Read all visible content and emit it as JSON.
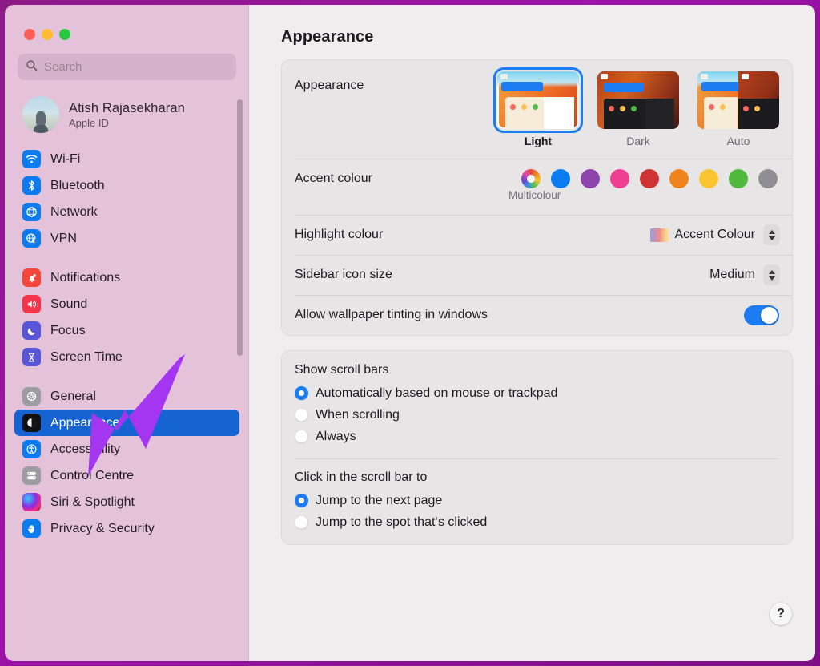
{
  "window": {
    "traffic_lights": [
      "close",
      "minimise",
      "zoom"
    ],
    "accent_hex": "#1d7cf2",
    "sidebar_bg_hex": "#e4c3da",
    "annotation_arrow_hex": "#a435f0"
  },
  "search": {
    "placeholder": "Search",
    "value": "",
    "icon": "search-icon"
  },
  "profile": {
    "name": "Atish Rajasekharan",
    "subtitle": "Apple ID",
    "avatar": "user-avatar"
  },
  "sidebar": {
    "groups": [
      {
        "items": [
          {
            "label": "Wi-Fi",
            "icon": "wifi-icon",
            "selected": false
          },
          {
            "label": "Bluetooth",
            "icon": "bluetooth-icon",
            "selected": false
          },
          {
            "label": "Network",
            "icon": "network-globe-icon",
            "selected": false
          },
          {
            "label": "VPN",
            "icon": "vpn-globe-icon",
            "selected": false
          }
        ]
      },
      {
        "items": [
          {
            "label": "Notifications",
            "icon": "notifications-bell-icon",
            "selected": false
          },
          {
            "label": "Sound",
            "icon": "sound-speaker-icon",
            "selected": false
          },
          {
            "label": "Focus",
            "icon": "focus-moon-icon",
            "selected": false
          },
          {
            "label": "Screen Time",
            "icon": "screen-time-hourglass-icon",
            "selected": false
          }
        ]
      },
      {
        "items": [
          {
            "label": "General",
            "icon": "general-gear-icon",
            "selected": false
          },
          {
            "label": "Appearance",
            "icon": "appearance-contrast-icon",
            "selected": true
          },
          {
            "label": "Accessibility",
            "icon": "accessibility-icon",
            "selected": false
          },
          {
            "label": "Control Centre",
            "icon": "control-centre-icon",
            "selected": false
          },
          {
            "label": "Siri & Spotlight",
            "icon": "siri-icon",
            "selected": false
          },
          {
            "label": "Privacy & Security",
            "icon": "privacy-hand-icon",
            "selected": false
          }
        ]
      }
    ]
  },
  "main": {
    "title": "Appearance",
    "appearance": {
      "label": "Appearance",
      "options": [
        {
          "label": "Light",
          "selected": true
        },
        {
          "label": "Dark",
          "selected": false
        },
        {
          "label": "Auto",
          "selected": false
        }
      ]
    },
    "accent": {
      "label": "Accent colour",
      "caption": "Multicolour",
      "swatches": [
        {
          "name": "Multicolour",
          "hex": "multi",
          "selected": true
        },
        {
          "name": "Blue",
          "hex": "#0b7cf0"
        },
        {
          "name": "Purple",
          "hex": "#8e44ad"
        },
        {
          "name": "Pink",
          "hex": "#ee3f92"
        },
        {
          "name": "Red",
          "hex": "#cf3434"
        },
        {
          "name": "Orange",
          "hex": "#f0851f"
        },
        {
          "name": "Yellow",
          "hex": "#fbc531"
        },
        {
          "name": "Green",
          "hex": "#52b93f"
        },
        {
          "name": "Graphite",
          "hex": "#8e8e93"
        }
      ]
    },
    "highlight": {
      "label": "Highlight colour",
      "value": "Accent Colour"
    },
    "sidebar_icon_size": {
      "label": "Sidebar icon size",
      "value": "Medium"
    },
    "wallpaper_tinting": {
      "label": "Allow wallpaper tinting in windows",
      "on": true
    },
    "show_scroll_bars": {
      "title": "Show scroll bars",
      "options": [
        {
          "label": "Automatically based on mouse or trackpad",
          "selected": true
        },
        {
          "label": "When scrolling",
          "selected": false
        },
        {
          "label": "Always",
          "selected": false
        }
      ]
    },
    "click_scroll_bar": {
      "title": "Click in the scroll bar to",
      "options": [
        {
          "label": "Jump to the next page",
          "selected": true
        },
        {
          "label": "Jump to the spot that‘s clicked",
          "selected": false
        }
      ]
    },
    "help_button": "?"
  }
}
